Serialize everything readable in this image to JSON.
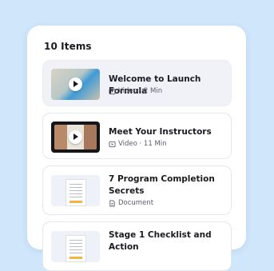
{
  "panel": {
    "count_label": "10 Items"
  },
  "items": [
    {
      "title": "Welcome to Launch Formula",
      "type": "Video",
      "meta": "Video · 2 Min",
      "icon": "video-icon",
      "active": true
    },
    {
      "title": "Meet Your Instructors",
      "type": "Video",
      "meta": "Video · 11 Min",
      "icon": "video-icon",
      "active": false
    },
    {
      "title": "7 Program Completion Secrets",
      "type": "Document",
      "meta": "Document",
      "icon": "document-icon",
      "active": false
    },
    {
      "title": "Stage 1 Checklist and Action",
      "type": "Document",
      "meta": "",
      "icon": "document-icon",
      "active": false
    }
  ],
  "colors": {
    "background": "#cfe6fb",
    "panel": "#ffffff",
    "active_item": "#f1f1f8"
  }
}
